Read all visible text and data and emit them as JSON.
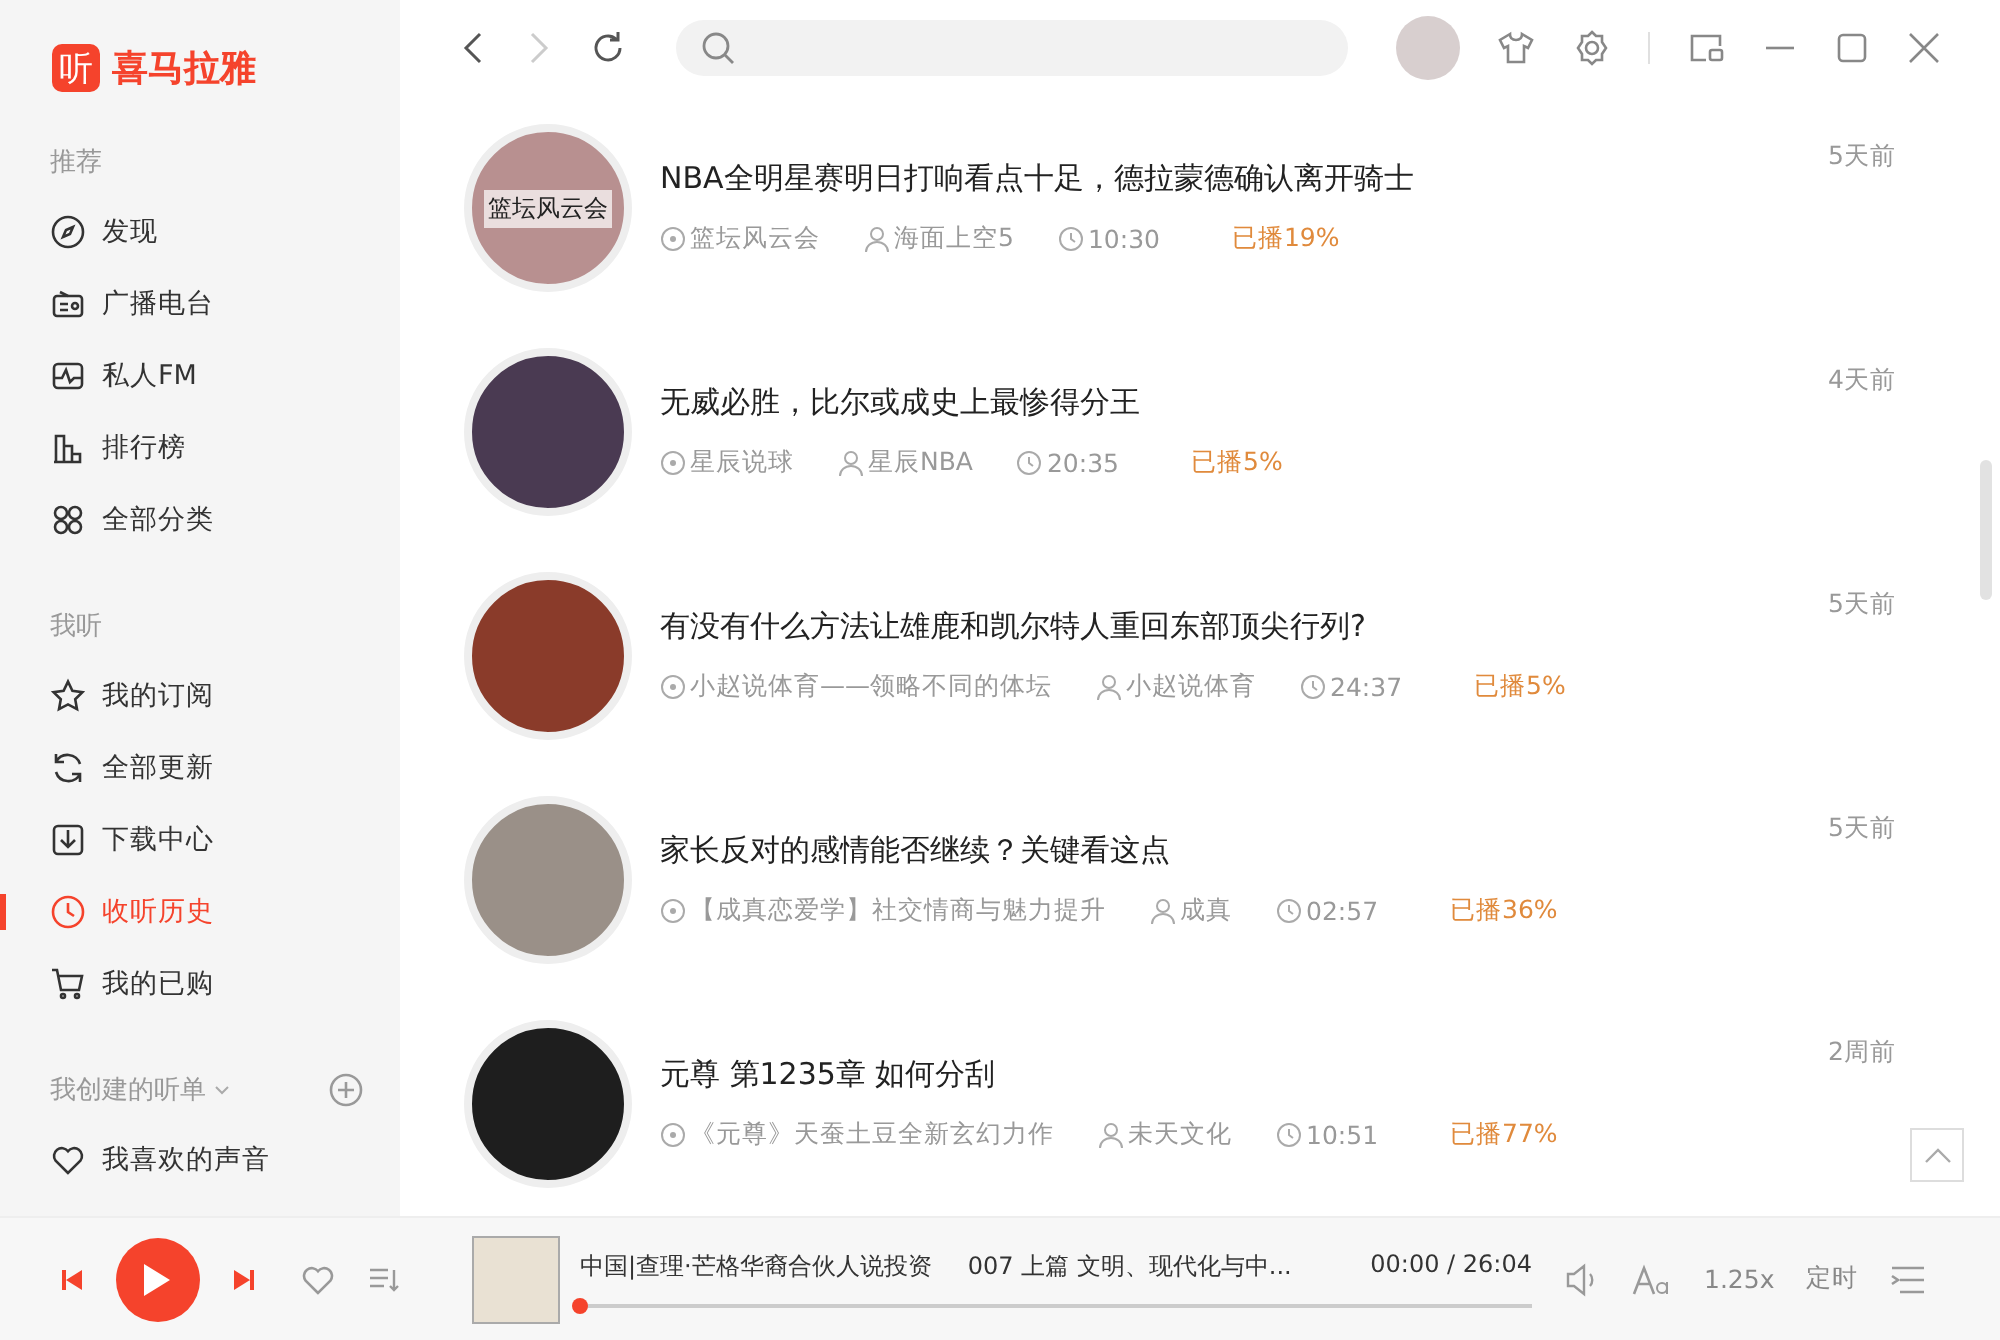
{
  "logo": {
    "badge": "听",
    "name": "喜马拉雅"
  },
  "sidebar": {
    "sections": [
      {
        "title": "推荐",
        "items": [
          {
            "label": "发现",
            "selected": false
          },
          {
            "label": "广播电台",
            "selected": false
          },
          {
            "label": "私人FM",
            "selected": false
          },
          {
            "label": "排行榜",
            "selected": false
          },
          {
            "label": "全部分类",
            "selected": false
          }
        ]
      },
      {
        "title": "我听",
        "items": [
          {
            "label": "我的订阅",
            "selected": false
          },
          {
            "label": "全部更新",
            "selected": false
          },
          {
            "label": "下载中心",
            "selected": false
          },
          {
            "label": "收听历史",
            "selected": true
          },
          {
            "label": "我的已购",
            "selected": false
          }
        ]
      },
      {
        "title": "我创建的听单",
        "items": [
          {
            "label": "我喜欢的声音",
            "selected": false
          }
        ]
      }
    ]
  },
  "history": [
    {
      "title": "NBA全明星赛明日打响看点十足，德拉蒙德确认离开骑士",
      "album": "篮坛风云会",
      "author": "海面上空5",
      "duration": "10:30",
      "played": "已播19%",
      "when": "5天前",
      "cover_label": "篮坛风云会"
    },
    {
      "title": "无威必胜，比尔或成史上最惨得分王",
      "album": "星辰说球",
      "author": "星辰NBA",
      "duration": "20:35",
      "played": "已播5%",
      "when": "4天前"
    },
    {
      "title": "有没有什么方法让雄鹿和凯尔特人重回东部顶尖行列?",
      "album": "小赵说体育——领略不同的体坛",
      "author": "小赵说体育",
      "duration": "24:37",
      "played": "已播5%",
      "when": "5天前"
    },
    {
      "title": "家长反对的感情能否继续？关键看这点",
      "album": "【成真恋爱学】社交情商与魅力提升",
      "author": "成真",
      "duration": "02:57",
      "played": "已播36%",
      "when": "5天前"
    },
    {
      "title": "元尊 第1235章 如何分刮",
      "album": "《元尊》天蚕土豆全新玄幻力作",
      "author": "未天文化",
      "duration": "10:51",
      "played": "已播77%",
      "when": "2周前"
    }
  ],
  "player": {
    "album": "中国|查理·芒格华裔合伙人说投资",
    "track": "007 上篇 文明、现代化与中...",
    "time": "00:00 / 26:04",
    "level": 0,
    "speed": "1.25x",
    "timer": "定时"
  }
}
